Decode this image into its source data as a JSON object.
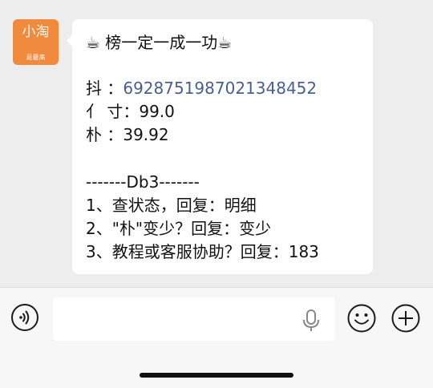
{
  "chat": {
    "avatar": {
      "main": "小淘",
      "sub": "返最高"
    },
    "message": {
      "line1": "☕ 榜一定一成一功☕",
      "line2_label": "抖   ：",
      "line2_value": "692875198702134845​2",
      "line3": "亻 寸：99.0",
      "line4": "朴   ：39.92",
      "line5": "-------Db3-------",
      "line6": "1、查状态，回复：明细",
      "line7": "2、\"朴\"变少？回复：变少",
      "line8": "3、教程或客服协助？回复：183"
    }
  },
  "input_bar": {
    "text_value": "",
    "icons": [
      "voice-icon",
      "mic-icon",
      "emoji-icon",
      "plus-icon"
    ]
  }
}
